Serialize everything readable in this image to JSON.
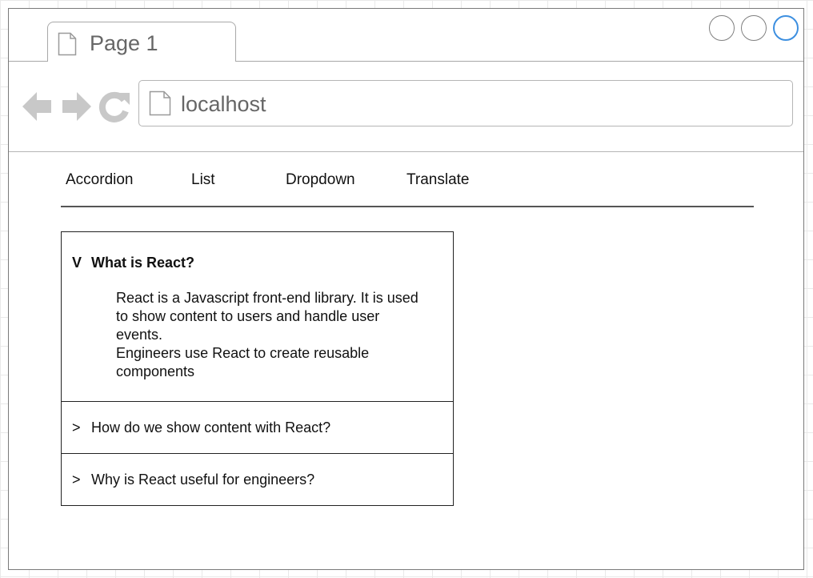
{
  "browser": {
    "tab_title": "Page 1",
    "url": "localhost"
  },
  "menu": {
    "items": [
      "Accordion",
      "List",
      "Dropdown",
      "Translate"
    ]
  },
  "accordion": {
    "items": [
      {
        "chevron": "V",
        "title": "What is React?",
        "expanded": true,
        "body": [
          "React is a Javascript front-end library. It is used",
          "to show content to users and handle user",
          "events.",
          "Engineers use React to create reusable",
          "components"
        ]
      },
      {
        "chevron": ">",
        "title": "How do we show content with React?",
        "expanded": false
      },
      {
        "chevron": ">",
        "title": "Why is React useful for engineers?",
        "expanded": false
      }
    ]
  },
  "icons": [
    "document-icon",
    "back-arrow-icon",
    "forward-arrow-icon",
    "reload-icon",
    "window-circle-icon"
  ],
  "colors": {
    "active_window_button": "#3d8fe0",
    "icon_gray": "#c8c8c8"
  }
}
